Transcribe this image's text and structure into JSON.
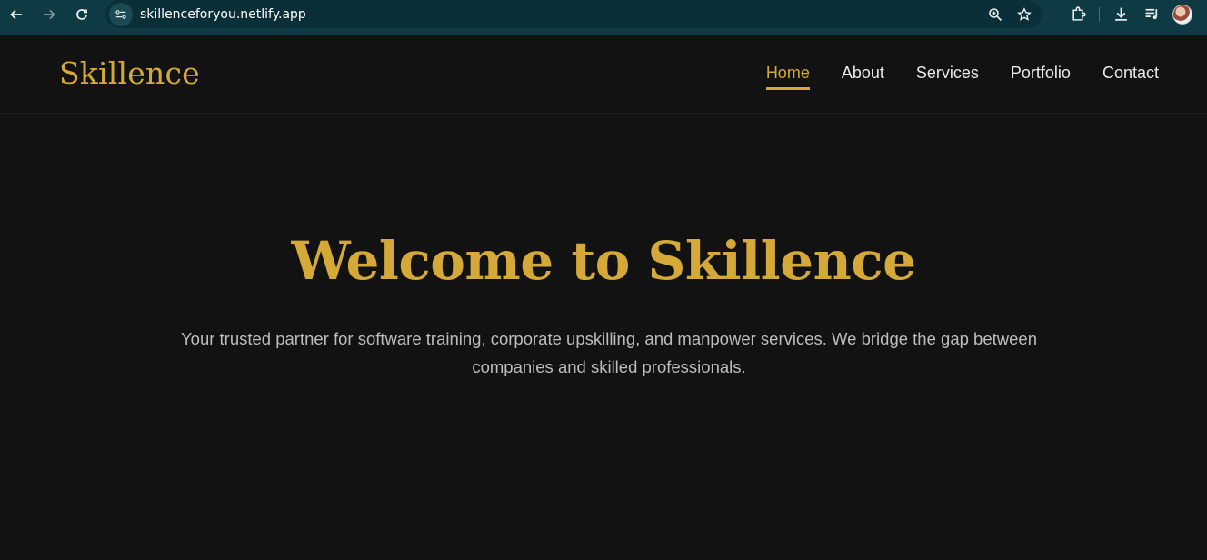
{
  "browser": {
    "url": "skillenceforyou.netlify.app",
    "icons": [
      "back-arrow-icon",
      "forward-arrow-icon",
      "reload-icon",
      "site-info-icon",
      "zoom-icon",
      "star-icon",
      "extensions-icon",
      "download-icon",
      "media-icon",
      "avatar"
    ]
  },
  "header": {
    "brand": "Skillence",
    "nav": [
      {
        "label": "Home",
        "active": true
      },
      {
        "label": "About"
      },
      {
        "label": "Services"
      },
      {
        "label": "Portfolio"
      },
      {
        "label": "Contact"
      }
    ]
  },
  "hero": {
    "title": "Welcome to Skillence",
    "subtitle": "Your trusted partner for software training, corporate upskilling, and manpower services. We bridge the gap between companies and skilled professionals."
  },
  "colors": {
    "accent": "#d4a937",
    "background": "#121212",
    "browser_chrome": "#0e3a44"
  }
}
